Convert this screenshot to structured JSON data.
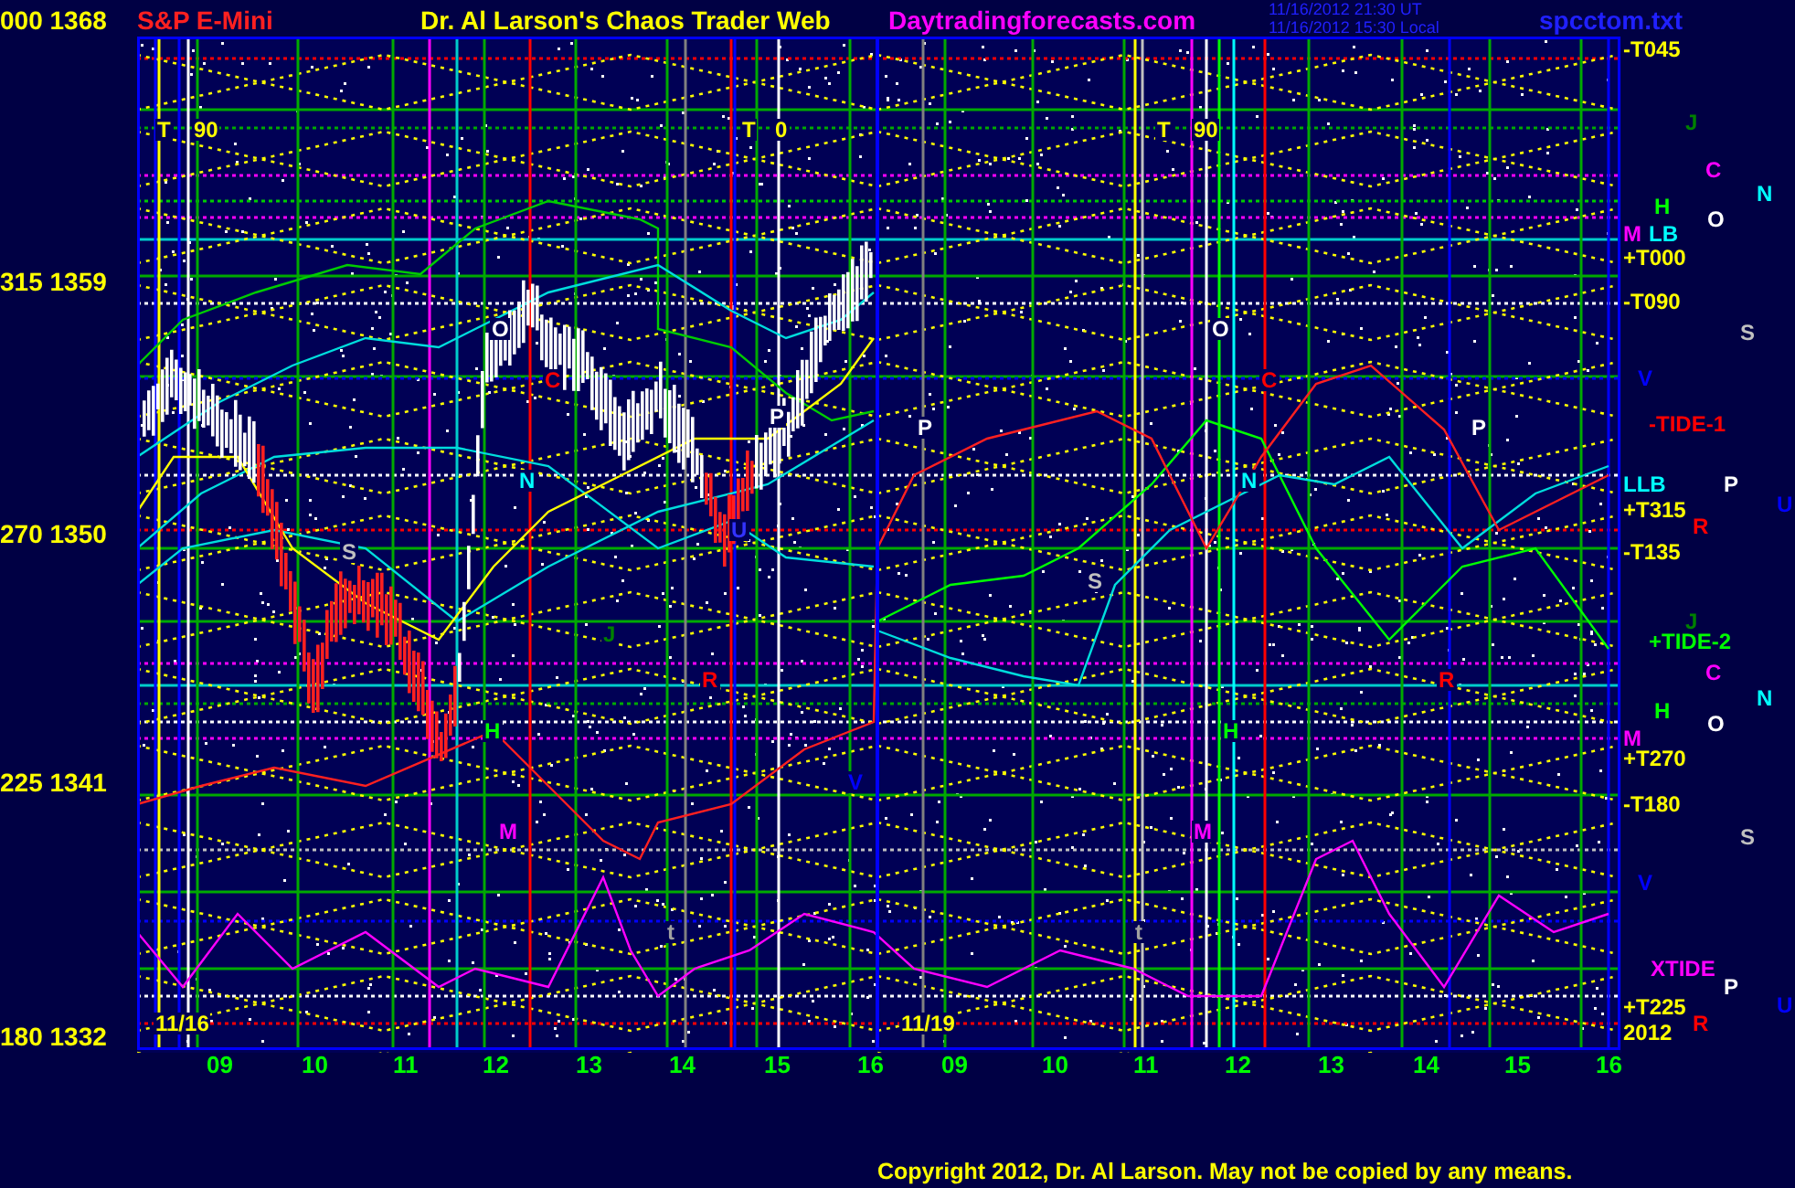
{
  "header": {
    "instrument": "S&P E-Mini",
    "title": "Dr. Al Larson's Chaos Trader Web",
    "website": "Daytradingforecasts.com",
    "timestamp_ut": "11/16/2012 21:30 UT",
    "timestamp_local": "11/16/2012 15:30 Local",
    "filename": "spcctom.txt"
  },
  "price_axis": [
    "000 1368",
    "315 1359",
    "270 1350",
    "225 1341",
    "180 1332"
  ],
  "cycle_labels": [
    {
      "letter": "T",
      "value": "90"
    },
    {
      "letter": "T",
      "value": "0"
    },
    {
      "letter": "T",
      "value": "90"
    }
  ],
  "plot_markers": [
    {
      "text": "O",
      "color": "#ffffff"
    },
    {
      "text": "C",
      "color": "#ff0000"
    },
    {
      "text": "N",
      "color": "#00ffff"
    },
    {
      "text": "P",
      "color": "#ffffff"
    },
    {
      "text": "P",
      "color": "#ffffff"
    },
    {
      "text": "O",
      "color": "#ffffff"
    },
    {
      "text": "C",
      "color": "#ff0000"
    },
    {
      "text": "N",
      "color": "#00ffff"
    },
    {
      "text": "S",
      "color": "#c0c0c0"
    },
    {
      "text": "S",
      "color": "#c0c0c0"
    },
    {
      "text": "P",
      "color": "#ffffff"
    },
    {
      "text": "R",
      "color": "#ff0000"
    },
    {
      "text": "R",
      "color": "#ff0000"
    },
    {
      "text": "J",
      "color": "#008000"
    },
    {
      "text": "H",
      "color": "#00ff00"
    },
    {
      "text": "H",
      "color": "#00ff00"
    },
    {
      "text": "M",
      "color": "#ff00ff"
    },
    {
      "text": "M",
      "color": "#ff00ff"
    },
    {
      "text": "V",
      "color": "#0000ff"
    },
    {
      "text": "U",
      "color": "#3333ff"
    },
    {
      "text": "t",
      "color": "#a0a0a0"
    },
    {
      "text": "t",
      "color": "#a0a0a0"
    }
  ],
  "date_labels": [
    "11/16",
    "11/19"
  ],
  "time_axis": [
    "09",
    "10",
    "11",
    "12",
    "13",
    "14",
    "15",
    "16",
    "09",
    "10",
    "11",
    "12",
    "13",
    "14",
    "15",
    "16"
  ],
  "right_labels": [
    {
      "text": "-T045",
      "color": "#ffff00"
    },
    {
      "text": "J",
      "color": "#008000"
    },
    {
      "text": "C",
      "color": "#ff00ff"
    },
    {
      "text": "N",
      "color": "#00ffff"
    },
    {
      "text": "H",
      "color": "#00ff00"
    },
    {
      "text": "O",
      "color": "#ffffff"
    },
    {
      "text": "M",
      "color": "#ff00ff"
    },
    {
      "text": "LB",
      "color": "#00ffff"
    },
    {
      "text": "+T000",
      "color": "#ffff00"
    },
    {
      "text": "-T090",
      "color": "#ffff00"
    },
    {
      "text": "S",
      "color": "#c0c0c0"
    },
    {
      "text": "V",
      "color": "#0000ff"
    },
    {
      "text": "-TIDE-1",
      "color": "#ff0000"
    },
    {
      "text": "LLB",
      "color": "#00ffff"
    },
    {
      "text": "P",
      "color": "#ffffff"
    },
    {
      "text": "U",
      "color": "#0000ff"
    },
    {
      "text": "+T315",
      "color": "#ffff00"
    },
    {
      "text": "R",
      "color": "#ff0000"
    },
    {
      "text": "-T135",
      "color": "#ffff00"
    },
    {
      "text": "J",
      "color": "#008000"
    },
    {
      "text": "+TIDE-2",
      "color": "#00ff00"
    },
    {
      "text": "C",
      "color": "#ff00ff"
    },
    {
      "text": "N",
      "color": "#00ffff"
    },
    {
      "text": "H",
      "color": "#00ff00"
    },
    {
      "text": "O",
      "color": "#ffffff"
    },
    {
      "text": "M",
      "color": "#ff00ff"
    },
    {
      "text": "+T270",
      "color": "#ffff00"
    },
    {
      "text": "-T180",
      "color": "#ffff00"
    },
    {
      "text": "S",
      "color": "#c0c0c0"
    },
    {
      "text": "V",
      "color": "#0000ff"
    },
    {
      "text": "XTIDE",
      "color": "#ff00ff"
    },
    {
      "text": "P",
      "color": "#ffffff"
    },
    {
      "text": "U",
      "color": "#0000ff"
    },
    {
      "text": "+T225",
      "color": "#ffff00"
    },
    {
      "text": "R",
      "color": "#ff0000"
    },
    {
      "text": "2012",
      "color": "#ffff00"
    }
  ],
  "copyright": "Copyright 2012, Dr. Al Larson. May not be copied by any means."
}
